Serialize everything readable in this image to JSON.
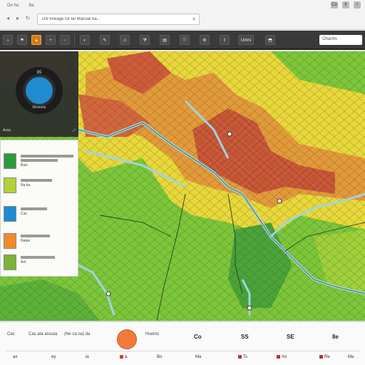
{
  "browser": {
    "tabs": [
      "On ho",
      "",
      "Ba",
      "",
      "",
      "",
      ""
    ],
    "address": "DN Imeage fur tel Manuel ba...",
    "right_icons": [
      "Co",
      "tl",
      "l"
    ]
  },
  "toolbar": {
    "buttons": [
      "",
      "",
      "",
      "",
      "",
      "",
      "",
      "",
      "",
      "",
      "",
      "",
      "Umni"
    ],
    "active_index": 1,
    "search_text": "Ohanhs"
  },
  "panel": {
    "gauge_value": "85",
    "gauge_unit": "Moxesta",
    "foot_left": "Aoss",
    "foot_right": ""
  },
  "legend": {
    "items": [
      {
        "color": "#2f9a3a",
        "label": "Buis"
      },
      {
        "color": "#b3d136",
        "label": "Na ba"
      },
      {
        "color": "#1f8ad6",
        "label": "Cas"
      },
      {
        "color": "#f08a2a",
        "label": "Natao"
      },
      {
        "color": "#7cb23a",
        "label": "Am"
      }
    ]
  },
  "bottom": {
    "row1": {
      "left": "Cas",
      "left2": "Cas ata ansuta",
      "left3": "(Ne ca na) da",
      "after_circle": "Hoonts",
      "icon1": "Co",
      "icon2": "SS",
      "icon3": "SE",
      "icon4": "8e"
    },
    "row2": [
      "ax",
      "ey",
      "ia",
      "a",
      "Bo",
      "Ma",
      "Ts",
      "Xo",
      "Re",
      "Ma"
    ]
  },
  "colors": {
    "toolbar_bg": "#3a3a3a",
    "accent": "#d97a14",
    "gauge": "#1e8ccf",
    "map_green": "#7cc63a",
    "map_yellow": "#e8d83a",
    "map_red": "#cf5a3a",
    "river": "#9ed6e0"
  },
  "icons": {
    "close": "close-icon",
    "search": "search-icon",
    "layers": "layers-icon",
    "settings": "gear-icon"
  }
}
